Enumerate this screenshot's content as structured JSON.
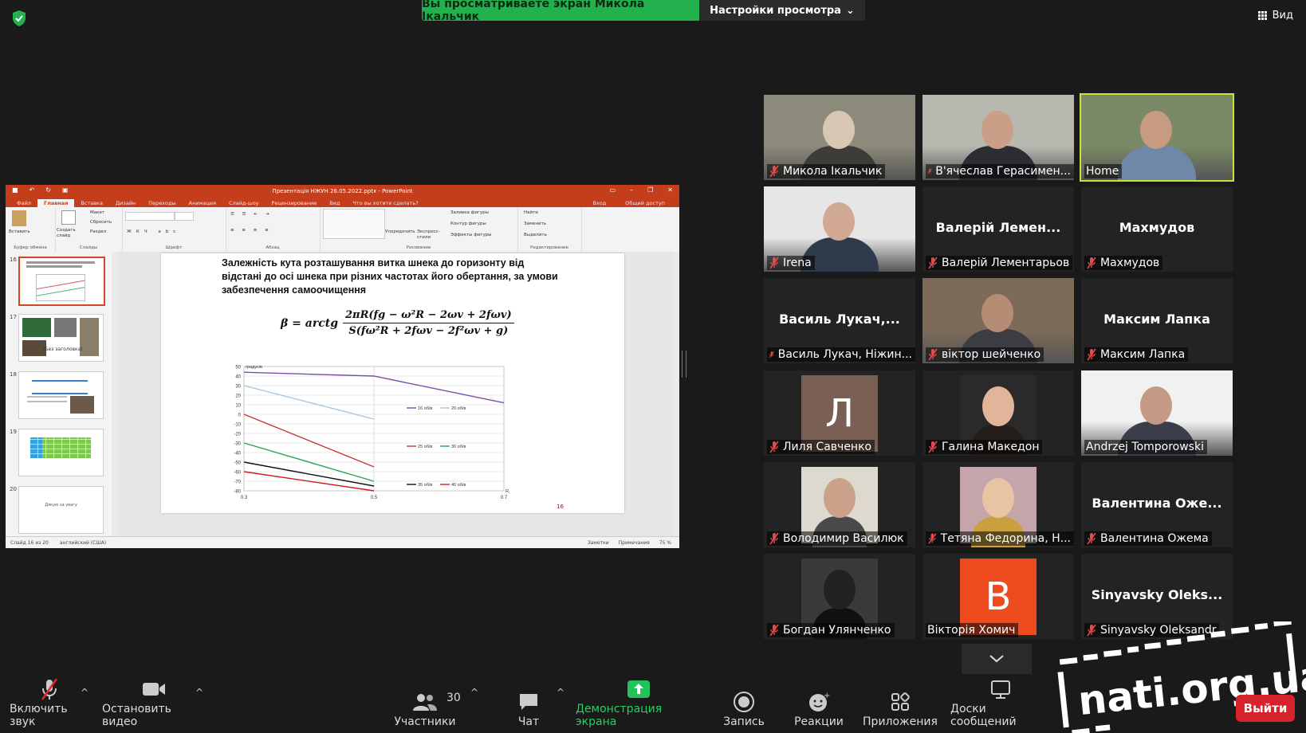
{
  "top_bar": {
    "viewing_banner": "Вы просматриваете экран Микола Ікальчик",
    "view_options": "Настройки просмотра",
    "view_button": "Вид"
  },
  "ppt": {
    "window_title": "Презентація НЖУН 26.05.2022.pptx - PowerPoint",
    "tabs": [
      "Файл",
      "Главная",
      "Вставка",
      "Дизайн",
      "Переходы",
      "Анимация",
      "Слайд-шоу",
      "Рецензирование",
      "Вид",
      "Что вы хотите сделать?"
    ],
    "tabs_right": [
      "Вход",
      "Общий доступ"
    ],
    "ribbon_groups": [
      "Буфер обмена",
      "Слайды",
      "Шрифт",
      "Абзац",
      "Рисование",
      "Редактирование"
    ],
    "ribbon_buttons": {
      "paste": "Вставить",
      "new_slide": "Создать слайд",
      "layout": "Макет",
      "reset": "Сбросить",
      "section": "Раздел",
      "arrange": "Упорядочить",
      "quick_styles": "Экспресс-стили",
      "shape_fill": "Заливка фигуры",
      "shape_outline": "Контур фигуры",
      "shape_effects": "Эффекты фигуры",
      "find": "Найти",
      "replace": "Заменить",
      "select": "Выделить"
    },
    "thumbnails": [
      {
        "num": "16",
        "label": ""
      },
      {
        "num": "17",
        "label": "(Без заголовка)"
      },
      {
        "num": "18",
        "label": ""
      },
      {
        "num": "19",
        "label": ""
      },
      {
        "num": "20",
        "label": "Дякую за увагу"
      }
    ],
    "slide": {
      "title": "Залежність кута розташування витка шнека до горизонту від відстані до осі шнека при різних частотах його обертання, за умови забезпечення самоочищення",
      "formula_lhs": "β = arctg",
      "formula_num": "2πR(fg − ω²R − 2ωv + 2fωv)",
      "formula_den": "S(fω²R + 2fωv − 2f²ωv + g)",
      "slide_number": "16"
    },
    "status": {
      "slide_info": "Слайд 16 из 20",
      "language": "английский (США)",
      "notes": "Заметки",
      "comments": "Примечания",
      "zoom": "75 %"
    }
  },
  "chart_data": {
    "type": "line",
    "ylabel": "градусів",
    "xlabel": "R, м",
    "x": [
      0.3,
      0.5,
      0.7
    ],
    "x_ticks": [
      "0.3",
      "0.5",
      "0.7"
    ],
    "ylim": [
      -80,
      50
    ],
    "y_ticks": [
      "50",
      "40",
      "30",
      "20",
      "10",
      "0",
      "-10",
      "-20",
      "-30",
      "-40",
      "-50",
      "-60",
      "-70",
      "-80"
    ],
    "series": [
      {
        "name": "16 об/в",
        "color": "#7b4fa6",
        "values": [
          44,
          40,
          12
        ]
      },
      {
        "name": "20 об/в",
        "color": "#a6c8dc",
        "values": [
          30,
          -5,
          null
        ]
      },
      {
        "name": "25 об/в",
        "color": "#c0393b",
        "values": [
          0,
          -55,
          null
        ]
      },
      {
        "name": "30 об/в",
        "color": "#2ea05a",
        "values": [
          -30,
          -70,
          null
        ]
      },
      {
        "name": "35 об/в",
        "color": "#111111",
        "values": [
          -50,
          -75,
          null
        ]
      },
      {
        "name": "40 об/в",
        "color": "#d01b1b",
        "values": [
          -60,
          -80,
          null
        ]
      }
    ]
  },
  "participants": [
    {
      "name": "Микола Ікальчик",
      "kind": "video",
      "muted": true
    },
    {
      "name": "В'ячеслав Герасимен...",
      "kind": "video",
      "muted": true
    },
    {
      "name": "Home",
      "kind": "video",
      "muted": false,
      "active_speaker": true
    },
    {
      "name": "Irena",
      "kind": "video",
      "muted": true
    },
    {
      "name": "Валерій Лементарьов",
      "display": "Валерій Лемен...",
      "kind": "name",
      "muted": true
    },
    {
      "name": "Махмудов",
      "display": "Махмудов",
      "kind": "name",
      "muted": true
    },
    {
      "name": "Василь Лукач, Ніжин...",
      "display": "Василь Лукач,...",
      "kind": "name",
      "muted": true
    },
    {
      "name": "віктор шейченко",
      "kind": "video",
      "muted": true
    },
    {
      "name": "Максим Лапка",
      "display": "Максим Лапка",
      "kind": "name",
      "muted": true
    },
    {
      "name": "Лиля Савченко",
      "letter": "Л",
      "letter_bg": "#7a5f55",
      "kind": "letter",
      "muted": true
    },
    {
      "name": "Галина Македон",
      "kind": "photo",
      "muted": true
    },
    {
      "name": "Andrzej Tomporowski",
      "kind": "video",
      "muted": false
    },
    {
      "name": "Володимир Василюк",
      "kind": "photo",
      "muted": true
    },
    {
      "name": "Тетяна Федорина, Н...",
      "kind": "photo",
      "muted": true
    },
    {
      "name": "Валентина Ожема",
      "display": "Валентина Оже...",
      "kind": "name",
      "muted": true
    },
    {
      "name": "Богдан Улянченко",
      "kind": "photo",
      "muted": true
    },
    {
      "name": "Вікторія Хомич",
      "letter": "В",
      "letter_bg": "#ee4c1f",
      "kind": "letter",
      "muted": false
    },
    {
      "name": "Sinyavsky Oleksandr",
      "display": "Sinyavsky Oleks...",
      "kind": "name",
      "muted": true
    }
  ],
  "toolbar": {
    "unmute": "Включить звук",
    "stop_video": "Остановить видео",
    "participants": "Участники",
    "participants_count": "30",
    "chat": "Чат",
    "share_screen": "Демонстрация экрана",
    "record": "Запись",
    "reactions": "Реакции",
    "apps": "Приложения",
    "whiteboards": "Доски сообщений",
    "leave": "Выйти"
  },
  "watermark": "nati.org.ua"
}
